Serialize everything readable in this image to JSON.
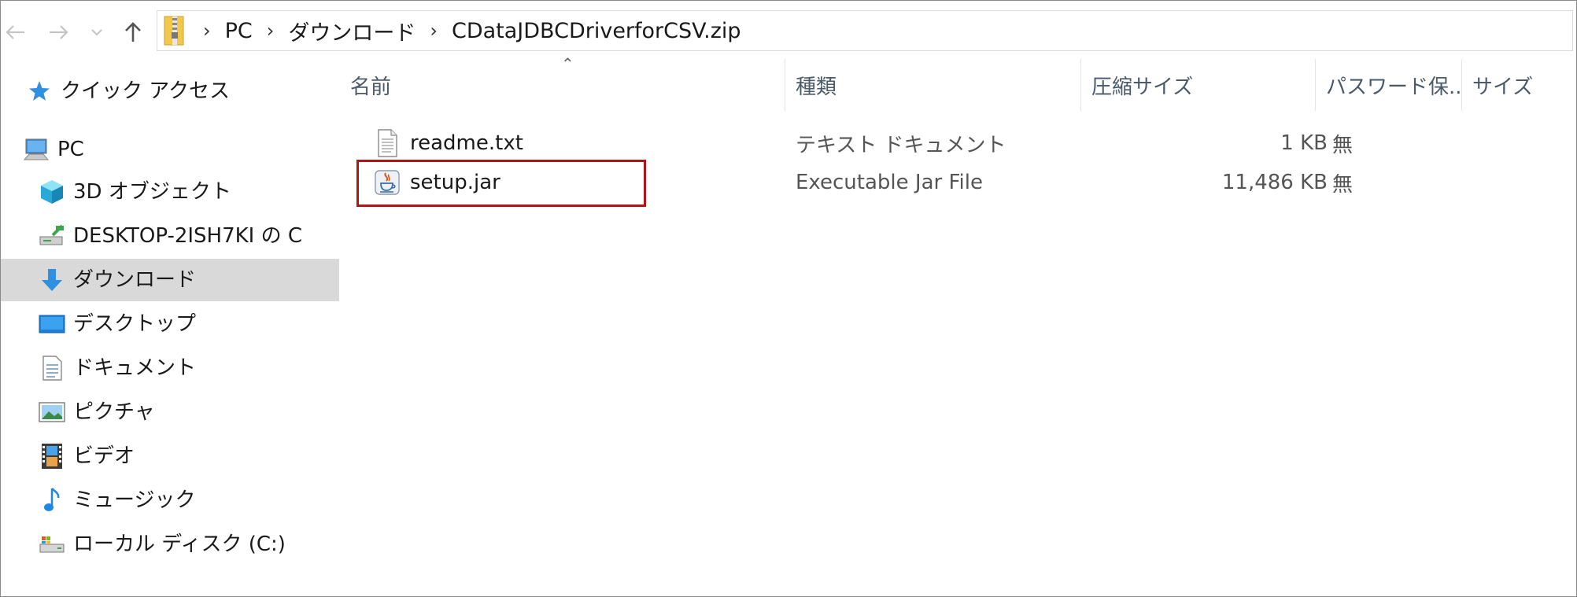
{
  "address_bar": {
    "breadcrumbs": [
      "PC",
      "ダウンロード",
      "CDataJDBCDriverforCSV.zip"
    ]
  },
  "sidebar": {
    "items": [
      {
        "label": "クイック アクセス",
        "icon": "star-icon"
      },
      {
        "label": "PC",
        "icon": "computer-icon"
      },
      {
        "label": "3D オブジェクト",
        "icon": "cube-icon"
      },
      {
        "label": "DESKTOP-2ISH7KI の C",
        "icon": "network-drive-icon"
      },
      {
        "label": "ダウンロード",
        "icon": "download-arrow-icon",
        "selected": true
      },
      {
        "label": "デスクトップ",
        "icon": "desktop-icon"
      },
      {
        "label": "ドキュメント",
        "icon": "document-icon"
      },
      {
        "label": "ピクチャ",
        "icon": "picture-icon"
      },
      {
        "label": "ビデオ",
        "icon": "video-icon"
      },
      {
        "label": "ミュージック",
        "icon": "music-note-icon"
      },
      {
        "label": "ローカル ディスク (C:)",
        "icon": "disk-icon"
      }
    ]
  },
  "columns": {
    "name": "名前",
    "type": "種類",
    "compressed_size": "圧縮サイズ",
    "password": "パスワード保...",
    "size": "サイズ"
  },
  "files": [
    {
      "name": "readme.txt",
      "type": "テキスト ドキュメント",
      "compressed_size": "1 KB",
      "password": "無",
      "icon": "text-file-icon"
    },
    {
      "name": "setup.jar",
      "type": "Executable Jar File",
      "compressed_size": "11,486 KB",
      "password": "無",
      "icon": "java-jar-icon"
    }
  ],
  "colors": {
    "highlight": "#b01414",
    "selected_bg": "#d9d9d9",
    "header_text": "#4a5a6a"
  }
}
